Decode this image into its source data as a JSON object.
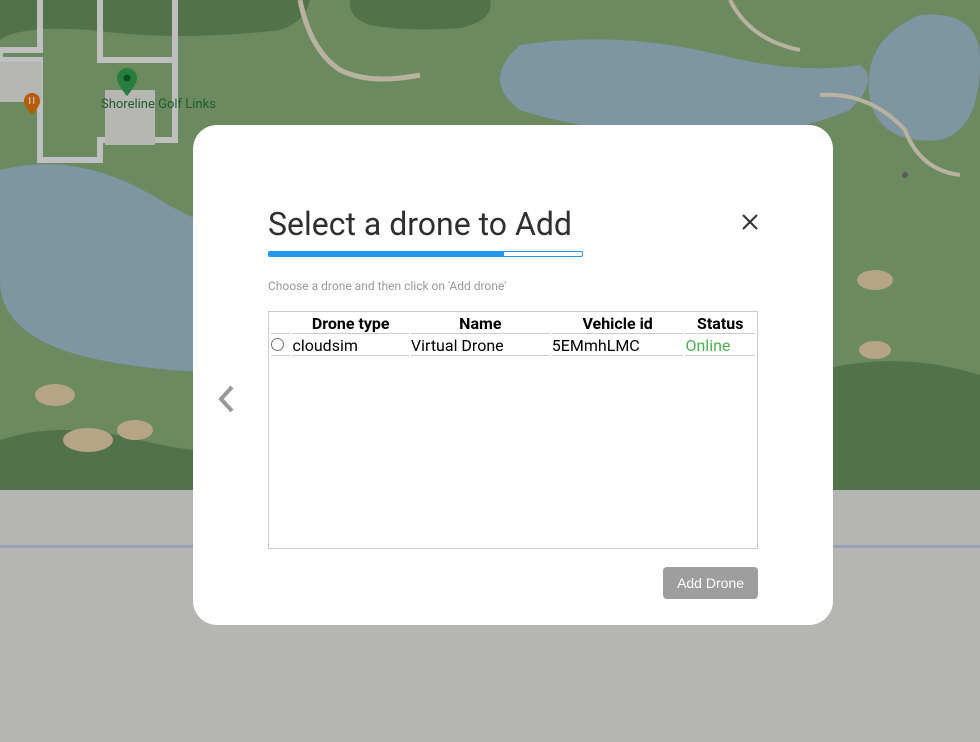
{
  "modal": {
    "title": "Select a drone to Add",
    "subtitle": "Choose a drone and then click on 'Add drone'",
    "add_button_label": "Add Drone"
  },
  "table": {
    "headers": {
      "drone_type": "Drone type",
      "name": "Name",
      "vehicle_id": "Vehicle id",
      "status": "Status"
    },
    "rows": [
      {
        "drone_type": "cloudsim",
        "name": "Virtual Drone",
        "vehicle_id": "5EMmhLMC",
        "status": "Online"
      }
    ]
  },
  "map": {
    "poi_label": "Shoreline Golf Links"
  }
}
